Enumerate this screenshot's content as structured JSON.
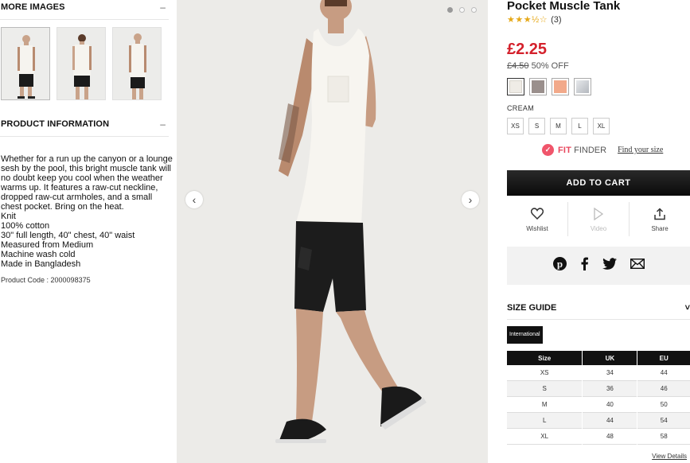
{
  "more_images": {
    "title": "MORE IMAGES",
    "toggle": "–"
  },
  "product_info": {
    "title": "PRODUCT INFORMATION",
    "toggle": "–",
    "lines": [
      "Whether for a run up the canyon or a lounge",
      "sesh by the pool, this bright muscle tank will",
      "no doubt keep you cool when the weather",
      "warms up. It features a raw-cut neckline,",
      "dropped raw-cut armholes, and a small",
      "chest pocket. Bring on the heat.",
      "Knit",
      "100% cotton",
      "30\" full length, 40\" chest, 40\" waist",
      "Measured from Medium",
      "Machine wash cold",
      "Made in Bangladesh"
    ],
    "product_code": "Product Code : 2000098375"
  },
  "gallery": {
    "prev": "‹",
    "next": "›"
  },
  "product": {
    "title": "Pocket Muscle Tank",
    "stars": "★★★½☆",
    "review_count": "(3)",
    "price": "£2.25",
    "old_price": "£4.50",
    "discount": "50% OFF",
    "swatches": [
      {
        "color": "#efece6"
      },
      {
        "color": "#9a8f8c"
      },
      {
        "color": "#f2a98a"
      },
      {
        "color": "#c9ccd1"
      }
    ],
    "selected_color": "CREAM",
    "sizes": [
      "XS",
      "S",
      "M",
      "L",
      "XL"
    ]
  },
  "fit_finder": {
    "label": "FIT",
    "label2": "FINDER",
    "link": "Find your size"
  },
  "add_to_cart": "ADD TO CART",
  "actions": {
    "wishlist": "Wishlist",
    "video": "Video",
    "share": "Share"
  },
  "size_guide": {
    "title": "SIZE GUIDE",
    "toggle": "˅",
    "region": "International",
    "headers": [
      "Size",
      "UK",
      "EU"
    ],
    "rows": [
      [
        "XS",
        "34",
        "44"
      ],
      [
        "S",
        "36",
        "46"
      ],
      [
        "M",
        "40",
        "50"
      ],
      [
        "L",
        "44",
        "54"
      ],
      [
        "XL",
        "48",
        "58"
      ]
    ],
    "view_details": "View Details"
  },
  "colors": {
    "price_red": "#d4212c",
    "fit_pink": "#e8465c",
    "dark": "#111111"
  }
}
